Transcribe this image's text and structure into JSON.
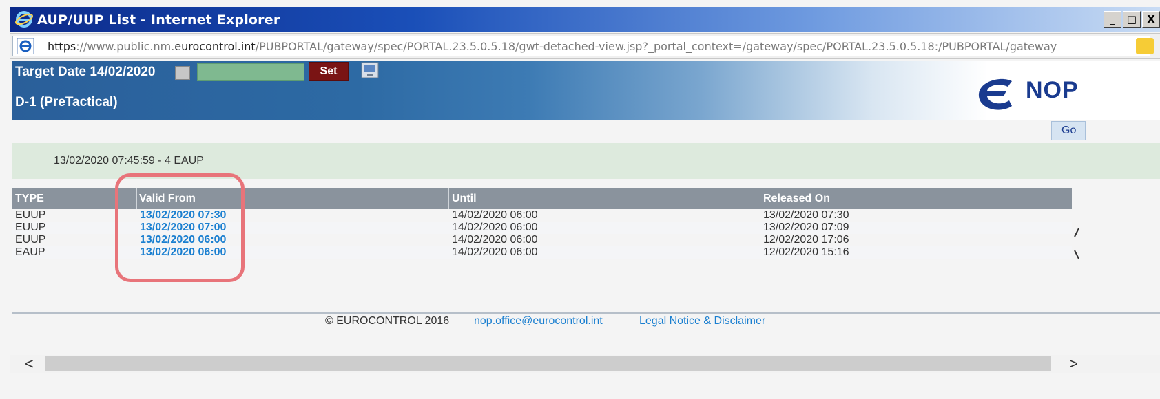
{
  "window": {
    "title": "AUP/UUP List - Internet Explorer",
    "minimize_label": "_",
    "maximize_label": "□",
    "close_label": "X"
  },
  "address_bar": {
    "protocol": "https",
    "url_prefix": "://www.public.nm.",
    "url_domain": "eurocontrol.int",
    "url_path": "/PUBPORTAL/gateway/spec/PORTAL.23.5.0.5.18/gwt-detached-view.jsp?_portal_context=/gateway/spec/PORTAL.23.5.0.5.18:/PUBPORTAL/gateway"
  },
  "header": {
    "target_date_label": "Target Date 14/02/2020",
    "date_input_value": "",
    "set_button": "Set",
    "phase_label": "D-1 (PreTactical)",
    "logo_text": "NOP",
    "go_button": "Go"
  },
  "info": {
    "text": "13/02/2020 07:45:59 - 4 EAUP"
  },
  "table": {
    "columns": [
      "TYPE",
      "Valid From",
      "Until",
      "Released On"
    ],
    "rows": [
      {
        "type": "EUUP",
        "valid_from": "13/02/2020 07:30",
        "until": "14/02/2020 06:00",
        "released_on": "13/02/2020 07:30"
      },
      {
        "type": "EUUP",
        "valid_from": "13/02/2020 07:00",
        "until": "14/02/2020 06:00",
        "released_on": "13/02/2020 07:09"
      },
      {
        "type": "EUUP",
        "valid_from": "13/02/2020 06:00",
        "until": "14/02/2020 06:00",
        "released_on": "12/02/2020 17:06"
      },
      {
        "type": "EAUP",
        "valid_from": "13/02/2020 06:00",
        "until": "14/02/2020 06:00",
        "released_on": "12/02/2020 15:16"
      }
    ]
  },
  "footer": {
    "copyright": "© EUROCONTROL 2016",
    "email": "nop.office@eurocontrol.int",
    "legal": "Legal Notice & Disclaimer"
  },
  "colors": {
    "titlebar": "#0c2a8a",
    "header_band": "#2a5f9a",
    "set_button": "#7a1414",
    "date_input": "#7fb990",
    "link": "#1a7fd0",
    "highlight": "#e8747a",
    "info_band": "#ddeadd",
    "table_header": "#8a939d"
  }
}
